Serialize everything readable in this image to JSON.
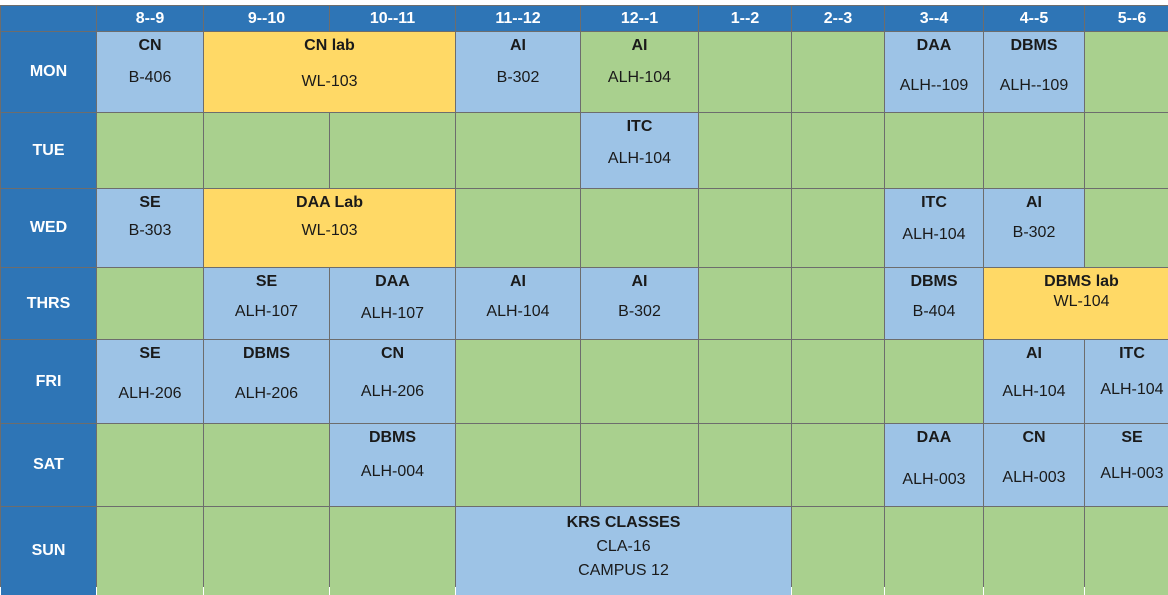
{
  "colors": {
    "header": "#2e75b6",
    "class": "#9dc3e6",
    "lab": "#ffd966",
    "free": "#a9d08e",
    "grid": "#6d6d6d"
  },
  "times": [
    "8--9",
    "9--10",
    "10--11",
    "11--12",
    "12--1",
    "1--2",
    "2--3",
    "3--4",
    "4--5",
    "5--6"
  ],
  "days": [
    "MON",
    "TUE",
    "WED",
    "THRS",
    "FRI",
    "SAT",
    "SUN"
  ],
  "mon": {
    "c1": {
      "subject": "CN",
      "room": "B-406"
    },
    "lab": {
      "subject": "CN lab",
      "room": "WL-103"
    },
    "c4": {
      "subject": "AI",
      "room": "B-302"
    },
    "c5": {
      "subject": "AI",
      "room": "ALH-104"
    },
    "c8": {
      "subject": "DAA",
      "room": "ALH--109"
    },
    "c9": {
      "subject": "DBMS",
      "room": "ALH--109"
    }
  },
  "tue": {
    "c5": {
      "subject": "ITC",
      "room": "ALH-104"
    }
  },
  "wed": {
    "c1": {
      "subject": "SE",
      "room": "B-303"
    },
    "lab": {
      "subject": "DAA Lab",
      "room": "WL-103"
    },
    "c8": {
      "subject": "ITC",
      "room": "ALH-104"
    },
    "c9": {
      "subject": "AI",
      "room": "B-302"
    }
  },
  "thu": {
    "c2": {
      "subject": "SE",
      "room": "ALH-107"
    },
    "c3": {
      "subject": "DAA",
      "room": "ALH-107"
    },
    "c4": {
      "subject": "AI",
      "room": "ALH-104"
    },
    "c5": {
      "subject": "AI",
      "room": "B-302"
    },
    "c8": {
      "subject": "DBMS",
      "room": "B-404"
    },
    "lab": {
      "subject": "DBMS lab",
      "room": "WL-104"
    }
  },
  "fri": {
    "c1": {
      "subject": "SE",
      "room": "ALH-206"
    },
    "c2": {
      "subject": "DBMS",
      "room": "ALH-206"
    },
    "c3": {
      "subject": "CN",
      "room": "ALH-206"
    },
    "c9": {
      "subject": "AI",
      "room": "ALH-104"
    },
    "c10": {
      "subject": "ITC",
      "room": "ALH-104"
    }
  },
  "sat": {
    "c3": {
      "subject": "DBMS",
      "room": "ALH-004"
    },
    "c8": {
      "subject": "DAA",
      "room": "ALH-003"
    },
    "c9": {
      "subject": "CN",
      "room": "ALH-003"
    },
    "c10": {
      "subject": "SE",
      "room": "ALH-003"
    }
  },
  "sun": {
    "krs": {
      "subject": "KRS CLASSES",
      "room": "CLA-16",
      "campus": "CAMPUS 12"
    }
  }
}
